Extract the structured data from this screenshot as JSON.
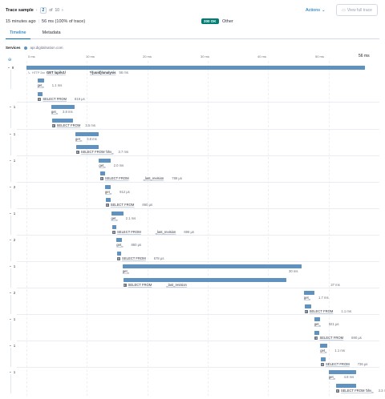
{
  "header": {
    "title": "Trace sample",
    "current": "2",
    "of_text": "of",
    "total": "10",
    "prev_glyph": "‹",
    "next_glyph": "›",
    "actions_label": "Actions",
    "view_full_trace": "View full trace"
  },
  "summary": {
    "time_ago": "15 minutes ago",
    "sep": "|",
    "duration": "56 ms (100% of trace)",
    "status": "200 OK",
    "type": "Other"
  },
  "tabs": [
    {
      "label": "Timeline",
      "active": true
    },
    {
      "label": "Metadata",
      "active": false
    }
  ],
  "services": {
    "label": "Services",
    "name": "api.digitalnation.com",
    "color": "#6092c0"
  },
  "timeline": {
    "total_ms": 56,
    "ticks": [
      "0 ms",
      "10 ms",
      "20 ms",
      "30 ms",
      "40 ms",
      "50 ms"
    ],
    "end_label": "56 ms",
    "bar_color": "#6092c0"
  },
  "groups": [
    {
      "count": "9"
    },
    {
      "count": "1"
    },
    {
      "count": "1"
    },
    {
      "count": "1"
    },
    {
      "count": "2"
    },
    {
      "count": "1"
    },
    {
      "count": "2"
    },
    {
      "count": "1"
    },
    {
      "count": "2"
    },
    {
      "count": "1"
    },
    {
      "count": "1"
    },
    {
      "count": "1"
    },
    {
      "count": "1"
    },
    {
      "count": "1"
    }
  ],
  "spans": [
    {
      "kind": "http",
      "method": "HTTP 2xx",
      "name": "GET /api/v1/",
      "name2": "*/{uuid}/analysis",
      "duration": "56 ms",
      "start_ms": 0,
      "dur_ms": 56
    },
    {
      "kind": "fn",
      "name": "get_",
      "duration": "1.1 ms",
      "start_ms": 1.8,
      "dur_ms": 1.1
    },
    {
      "kind": "db",
      "name": "SELECT FROM",
      "duration": "819 µs",
      "start_ms": 1.9,
      "dur_ms": 0.82
    },
    {
      "kind": "fn",
      "name": "get_",
      "duration": "3.8 ms",
      "start_ms": 4.1,
      "dur_ms": 3.8
    },
    {
      "kind": "db",
      "name": "SELECT FROM",
      "duration": "3.5 ms",
      "start_ms": 4.2,
      "dur_ms": 3.5
    },
    {
      "kind": "fn",
      "name": "get_",
      "duration": "3.8 ms",
      "start_ms": 8.1,
      "dur_ms": 3.8
    },
    {
      "kind": "db",
      "name": "SELECT FROM 'bhv_",
      "duration": "3.7 ms",
      "start_ms": 8.2,
      "dur_ms": 3.7
    },
    {
      "kind": "fn",
      "name": "get_",
      "duration": "2.0 ms",
      "start_ms": 12.0,
      "dur_ms": 2.0
    },
    {
      "kind": "db",
      "name": "SELECT FROM",
      "name2": "_last_revision",
      "duration": "789 µs",
      "start_ms": 12.2,
      "dur_ms": 0.79
    },
    {
      "kind": "fn",
      "name": "get_",
      "duration": "912 µs",
      "start_ms": 13.0,
      "dur_ms": 0.91
    },
    {
      "kind": "db",
      "name": "SELECT FROM",
      "duration": "860 µs",
      "start_ms": 13.1,
      "dur_ms": 0.86
    },
    {
      "kind": "fn",
      "name": "get_",
      "duration": "2.1 ms",
      "start_ms": 14.0,
      "dur_ms": 2.1
    },
    {
      "kind": "db",
      "name": "SELECT FROM",
      "name2": "_last_revision",
      "duration": "696 µs",
      "start_ms": 14.2,
      "dur_ms": 0.7
    },
    {
      "kind": "fn",
      "name": "get_",
      "duration": "860 µs",
      "start_ms": 14.9,
      "dur_ms": 0.86
    },
    {
      "kind": "db",
      "name": "SELECT FROM",
      "duration": "678 µs",
      "start_ms": 15.0,
      "dur_ms": 0.68
    },
    {
      "kind": "fn",
      "name": "get_",
      "duration": "30 ms",
      "start_ms": 15.9,
      "dur_ms": 29.6
    },
    {
      "kind": "db",
      "name": "SELECT FROM",
      "name2": "_last_revision",
      "duration": "27 ms",
      "start_ms": 16.0,
      "dur_ms": 27.0
    },
    {
      "kind": "fn",
      "name": "get_",
      "duration": "1.7 ms",
      "start_ms": 45.9,
      "dur_ms": 1.7
    },
    {
      "kind": "db",
      "name": "SELECT FROM",
      "duration": "1.1 ms",
      "start_ms": 46.0,
      "dur_ms": 1.1
    },
    {
      "kind": "fn",
      "name": "get_",
      "duration": "921 µs",
      "start_ms": 47.6,
      "dur_ms": 0.92
    },
    {
      "kind": "db",
      "name": "SELECT FROM",
      "duration": "690 µs",
      "start_ms": 47.7,
      "dur_ms": 0.69
    },
    {
      "kind": "fn",
      "name": "get_",
      "duration": "1.1 ms",
      "start_ms": 48.6,
      "dur_ms": 1.1
    },
    {
      "kind": "db",
      "name": "SELECT FROM",
      "duration": "736 µs",
      "start_ms": 48.7,
      "dur_ms": 0.74
    },
    {
      "kind": "fn",
      "name": "get_",
      "duration": "4.8 ms",
      "start_ms": 50.0,
      "dur_ms": 4.6
    },
    {
      "kind": "db",
      "name": "SELECT FROM 'bhv_",
      "duration": "3.3 ms",
      "start_ms": 51.2,
      "dur_ms": 3.3
    }
  ]
}
